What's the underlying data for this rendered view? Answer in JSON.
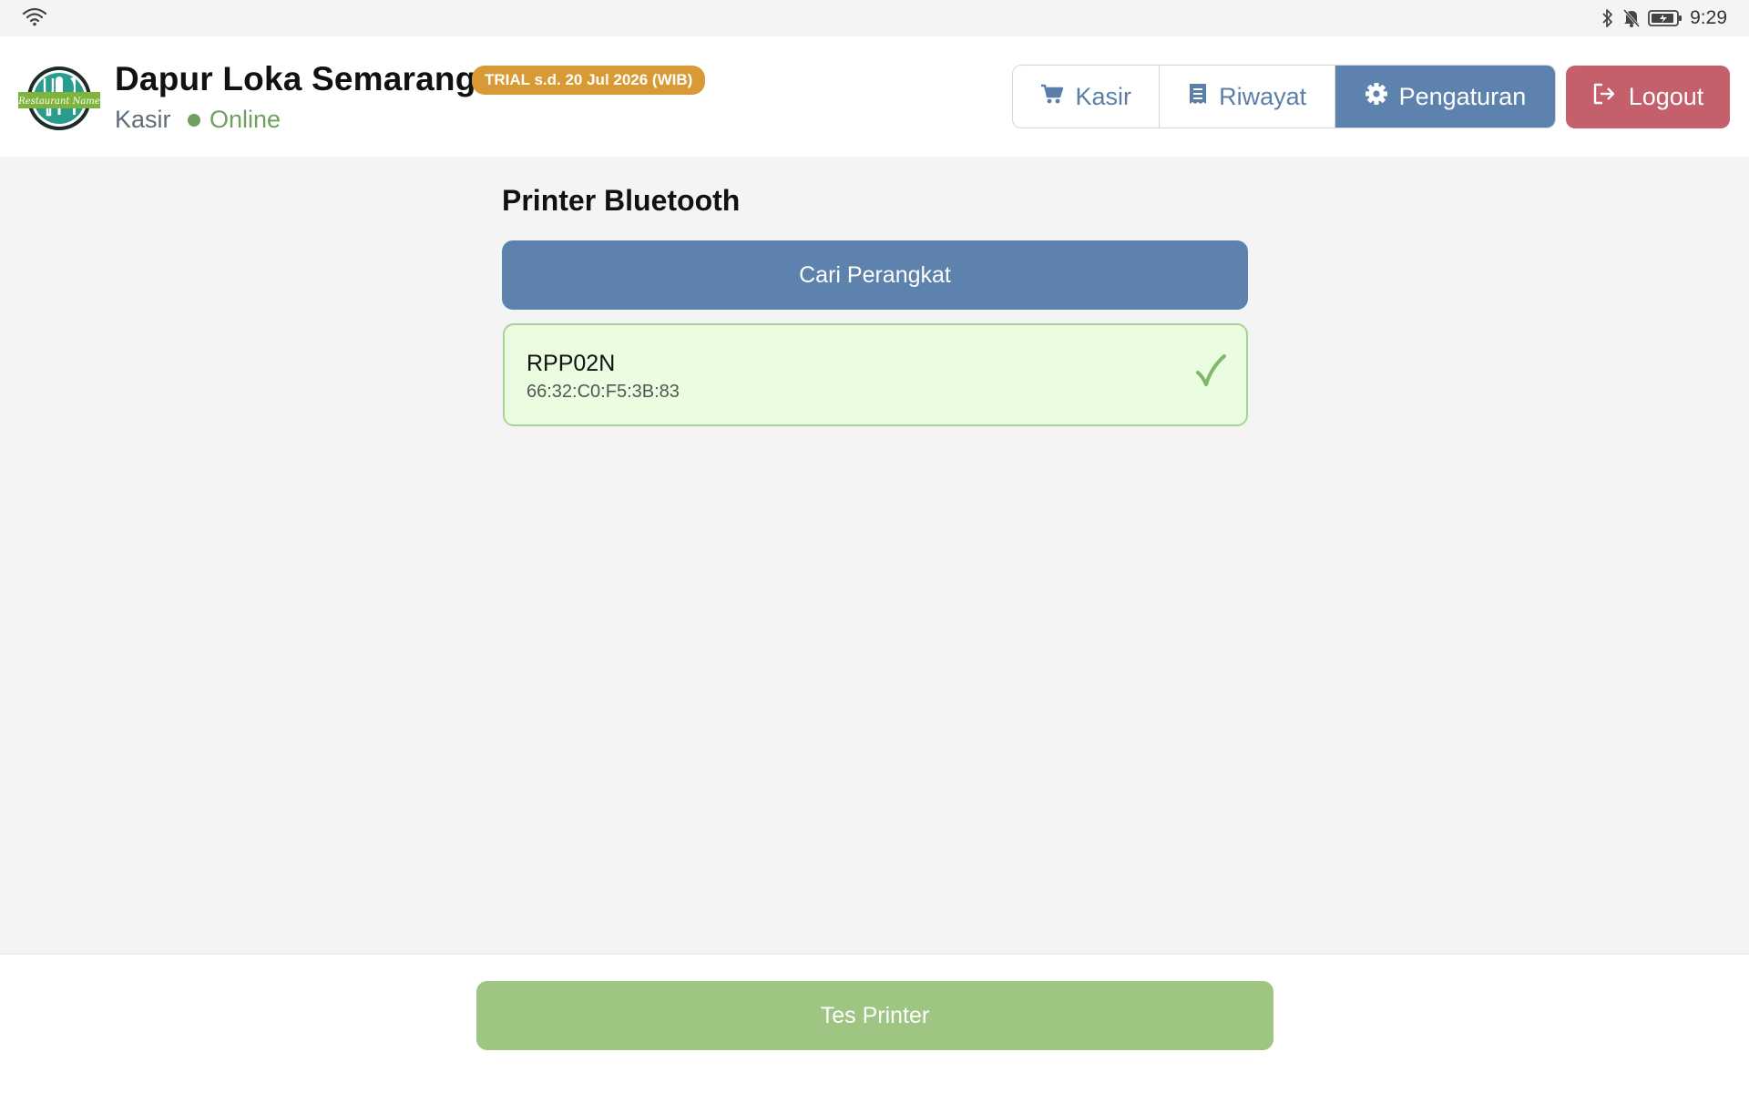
{
  "status_bar": {
    "time": "9:29"
  },
  "header": {
    "brand_name": "Dapur Loka Semarang",
    "trial_badge": "TRIAL s.d. 20 Jul 2026 (WIB)",
    "role": "Kasir",
    "connection_status": "Online",
    "logo_text": "Restaurant Name"
  },
  "nav": {
    "tabs": [
      {
        "label": "Kasir",
        "icon": "cart-icon",
        "active": false
      },
      {
        "label": "Riwayat",
        "icon": "receipt-icon",
        "active": false
      },
      {
        "label": "Pengaturan",
        "icon": "gear-icon",
        "active": true
      }
    ],
    "logout_label": "Logout"
  },
  "main": {
    "section_title": "Printer Bluetooth",
    "search_button_label": "Cari Perangkat",
    "devices": [
      {
        "name": "RPP02N",
        "address": "66:32:C0:F5:3B:83",
        "selected": true
      }
    ]
  },
  "footer": {
    "test_button_label": "Tes Printer"
  },
  "colors": {
    "primary": "#5e82ae",
    "danger": "#c45f6c",
    "success": "#9ec582",
    "trial_badge": "#d99a36",
    "online": "#6fa05f",
    "device_selected_bg": "#ebfde0"
  }
}
